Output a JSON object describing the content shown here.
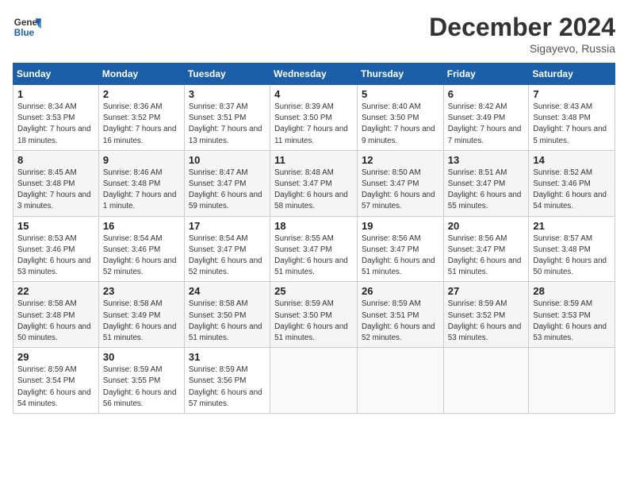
{
  "header": {
    "logo_general": "General",
    "logo_blue": "Blue",
    "month": "December 2024",
    "location": "Sigayevo, Russia"
  },
  "days_of_week": [
    "Sunday",
    "Monday",
    "Tuesday",
    "Wednesday",
    "Thursday",
    "Friday",
    "Saturday"
  ],
  "weeks": [
    [
      {
        "day": "1",
        "sunrise": "Sunrise: 8:34 AM",
        "sunset": "Sunset: 3:53 PM",
        "daylight": "Daylight: 7 hours and 18 minutes."
      },
      {
        "day": "2",
        "sunrise": "Sunrise: 8:36 AM",
        "sunset": "Sunset: 3:52 PM",
        "daylight": "Daylight: 7 hours and 16 minutes."
      },
      {
        "day": "3",
        "sunrise": "Sunrise: 8:37 AM",
        "sunset": "Sunset: 3:51 PM",
        "daylight": "Daylight: 7 hours and 13 minutes."
      },
      {
        "day": "4",
        "sunrise": "Sunrise: 8:39 AM",
        "sunset": "Sunset: 3:50 PM",
        "daylight": "Daylight: 7 hours and 11 minutes."
      },
      {
        "day": "5",
        "sunrise": "Sunrise: 8:40 AM",
        "sunset": "Sunset: 3:50 PM",
        "daylight": "Daylight: 7 hours and 9 minutes."
      },
      {
        "day": "6",
        "sunrise": "Sunrise: 8:42 AM",
        "sunset": "Sunset: 3:49 PM",
        "daylight": "Daylight: 7 hours and 7 minutes."
      },
      {
        "day": "7",
        "sunrise": "Sunrise: 8:43 AM",
        "sunset": "Sunset: 3:48 PM",
        "daylight": "Daylight: 7 hours and 5 minutes."
      }
    ],
    [
      {
        "day": "8",
        "sunrise": "Sunrise: 8:45 AM",
        "sunset": "Sunset: 3:48 PM",
        "daylight": "Daylight: 7 hours and 3 minutes."
      },
      {
        "day": "9",
        "sunrise": "Sunrise: 8:46 AM",
        "sunset": "Sunset: 3:48 PM",
        "daylight": "Daylight: 7 hours and 1 minute."
      },
      {
        "day": "10",
        "sunrise": "Sunrise: 8:47 AM",
        "sunset": "Sunset: 3:47 PM",
        "daylight": "Daylight: 6 hours and 59 minutes."
      },
      {
        "day": "11",
        "sunrise": "Sunrise: 8:48 AM",
        "sunset": "Sunset: 3:47 PM",
        "daylight": "Daylight: 6 hours and 58 minutes."
      },
      {
        "day": "12",
        "sunrise": "Sunrise: 8:50 AM",
        "sunset": "Sunset: 3:47 PM",
        "daylight": "Daylight: 6 hours and 57 minutes."
      },
      {
        "day": "13",
        "sunrise": "Sunrise: 8:51 AM",
        "sunset": "Sunset: 3:47 PM",
        "daylight": "Daylight: 6 hours and 55 minutes."
      },
      {
        "day": "14",
        "sunrise": "Sunrise: 8:52 AM",
        "sunset": "Sunset: 3:46 PM",
        "daylight": "Daylight: 6 hours and 54 minutes."
      }
    ],
    [
      {
        "day": "15",
        "sunrise": "Sunrise: 8:53 AM",
        "sunset": "Sunset: 3:46 PM",
        "daylight": "Daylight: 6 hours and 53 minutes."
      },
      {
        "day": "16",
        "sunrise": "Sunrise: 8:54 AM",
        "sunset": "Sunset: 3:46 PM",
        "daylight": "Daylight: 6 hours and 52 minutes."
      },
      {
        "day": "17",
        "sunrise": "Sunrise: 8:54 AM",
        "sunset": "Sunset: 3:47 PM",
        "daylight": "Daylight: 6 hours and 52 minutes."
      },
      {
        "day": "18",
        "sunrise": "Sunrise: 8:55 AM",
        "sunset": "Sunset: 3:47 PM",
        "daylight": "Daylight: 6 hours and 51 minutes."
      },
      {
        "day": "19",
        "sunrise": "Sunrise: 8:56 AM",
        "sunset": "Sunset: 3:47 PM",
        "daylight": "Daylight: 6 hours and 51 minutes."
      },
      {
        "day": "20",
        "sunrise": "Sunrise: 8:56 AM",
        "sunset": "Sunset: 3:47 PM",
        "daylight": "Daylight: 6 hours and 51 minutes."
      },
      {
        "day": "21",
        "sunrise": "Sunrise: 8:57 AM",
        "sunset": "Sunset: 3:48 PM",
        "daylight": "Daylight: 6 hours and 50 minutes."
      }
    ],
    [
      {
        "day": "22",
        "sunrise": "Sunrise: 8:58 AM",
        "sunset": "Sunset: 3:48 PM",
        "daylight": "Daylight: 6 hours and 50 minutes."
      },
      {
        "day": "23",
        "sunrise": "Sunrise: 8:58 AM",
        "sunset": "Sunset: 3:49 PM",
        "daylight": "Daylight: 6 hours and 51 minutes."
      },
      {
        "day": "24",
        "sunrise": "Sunrise: 8:58 AM",
        "sunset": "Sunset: 3:50 PM",
        "daylight": "Daylight: 6 hours and 51 minutes."
      },
      {
        "day": "25",
        "sunrise": "Sunrise: 8:59 AM",
        "sunset": "Sunset: 3:50 PM",
        "daylight": "Daylight: 6 hours and 51 minutes."
      },
      {
        "day": "26",
        "sunrise": "Sunrise: 8:59 AM",
        "sunset": "Sunset: 3:51 PM",
        "daylight": "Daylight: 6 hours and 52 minutes."
      },
      {
        "day": "27",
        "sunrise": "Sunrise: 8:59 AM",
        "sunset": "Sunset: 3:52 PM",
        "daylight": "Daylight: 6 hours and 53 minutes."
      },
      {
        "day": "28",
        "sunrise": "Sunrise: 8:59 AM",
        "sunset": "Sunset: 3:53 PM",
        "daylight": "Daylight: 6 hours and 53 minutes."
      }
    ],
    [
      {
        "day": "29",
        "sunrise": "Sunrise: 8:59 AM",
        "sunset": "Sunset: 3:54 PM",
        "daylight": "Daylight: 6 hours and 54 minutes."
      },
      {
        "day": "30",
        "sunrise": "Sunrise: 8:59 AM",
        "sunset": "Sunset: 3:55 PM",
        "daylight": "Daylight: 6 hours and 56 minutes."
      },
      {
        "day": "31",
        "sunrise": "Sunrise: 8:59 AM",
        "sunset": "Sunset: 3:56 PM",
        "daylight": "Daylight: 6 hours and 57 minutes."
      },
      null,
      null,
      null,
      null
    ]
  ]
}
